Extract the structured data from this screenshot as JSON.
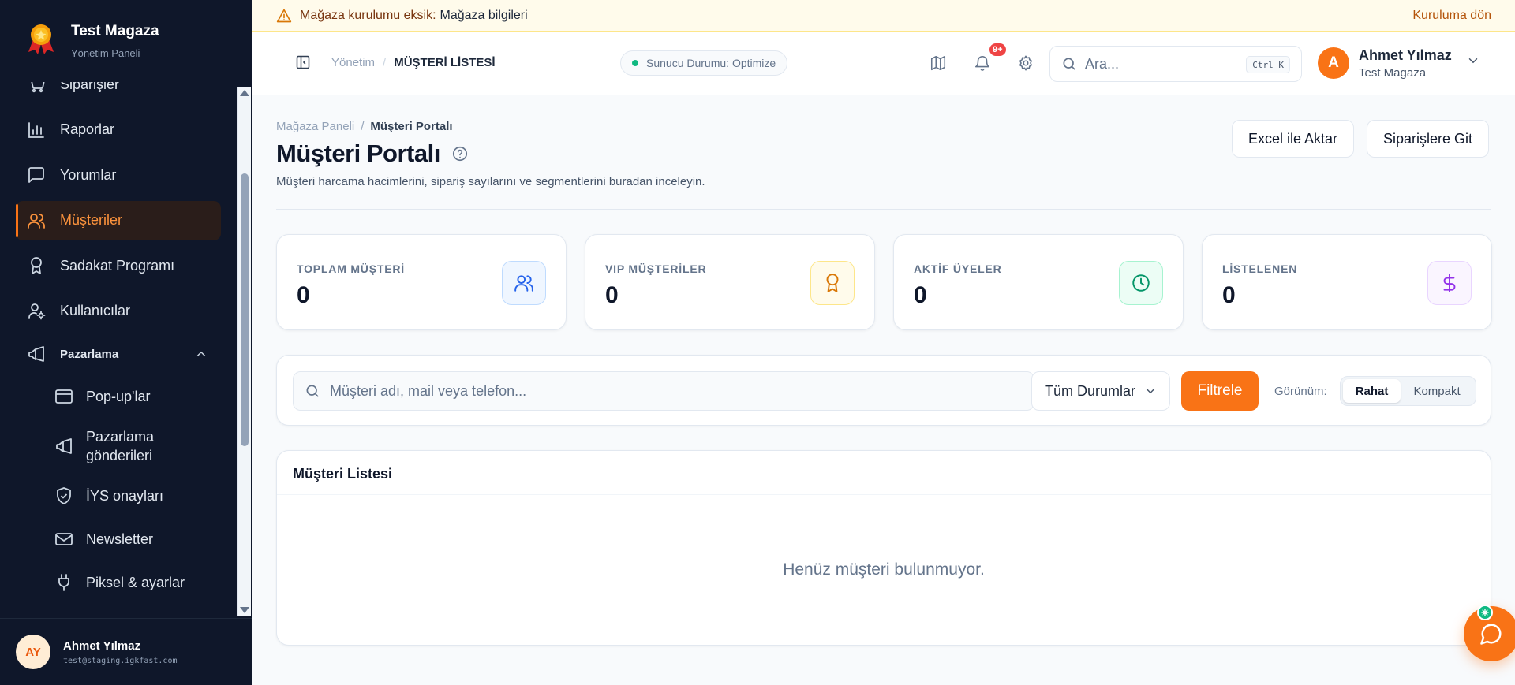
{
  "brand": {
    "name": "Test Magaza",
    "subtitle": "Yönetim Paneli"
  },
  "sidebar": {
    "items": [
      {
        "label": "Siparişler",
        "icon": "shopping-cart-icon"
      },
      {
        "label": "Raporlar",
        "icon": "bar-chart-icon"
      },
      {
        "label": "Yorumlar",
        "icon": "message-square-icon"
      },
      {
        "label": "Müşteriler",
        "icon": "users-icon",
        "active": true
      },
      {
        "label": "Sadakat Programı",
        "icon": "award-icon"
      },
      {
        "label": "Kullanıcılar",
        "icon": "user-cog-icon"
      }
    ],
    "group": {
      "label": "Pazarlama",
      "icon": "megaphone-icon",
      "expanded": true,
      "items": [
        {
          "label": "Pop-up'lar",
          "icon": "browser-window-icon"
        },
        {
          "label": "Pazarlama gönderileri",
          "icon": "megaphone-icon"
        },
        {
          "label": "İYS onayları",
          "icon": "shield-check-icon"
        },
        {
          "label": "Newsletter",
          "icon": "mail-icon"
        },
        {
          "label": "Piksel & ayarlar",
          "icon": "plug-icon"
        }
      ]
    },
    "user": {
      "initials": "AY",
      "name": "Ahmet Yılmaz",
      "email": "test@staging.igkfast.com"
    }
  },
  "banner": {
    "text": "Mağaza kurulumu eksik:",
    "highlight": "Mağaza bilgileri",
    "action": "Kuruluma dön"
  },
  "header": {
    "breadcrumb": [
      "Yönetim",
      "MÜŞTERİ LİSTESİ"
    ],
    "status": "Sunucu Durumu: Optimize",
    "notifications_badge": "9+",
    "search_placeholder": "Ara...",
    "search_shortcut": "Ctrl K",
    "user": {
      "initial": "A",
      "name": "Ahmet Yılmaz",
      "store": "Test Magaza"
    }
  },
  "page": {
    "breadcrumb": [
      "Mağaza Paneli",
      "Müşteri Portalı"
    ],
    "title": "Müşteri Portalı",
    "description": "Müşteri harcama hacimlerini, sipariş sayılarını ve segmentlerini buradan inceleyin.",
    "actions": {
      "export": "Excel ile Aktar",
      "orders": "Siparişlere Git"
    }
  },
  "stats": [
    {
      "label": "TOPLAM MÜŞTERİ",
      "value": "0",
      "icon": "users-icon",
      "color": "#2563eb",
      "bg": "#eff6ff"
    },
    {
      "label": "VIP MÜŞTERİLER",
      "value": "0",
      "icon": "award-icon",
      "color": "#d97706",
      "bg": "#fffbeb"
    },
    {
      "label": "AKTİF ÜYELER",
      "value": "0",
      "icon": "clock-icon",
      "color": "#059669",
      "bg": "#ecfdf5"
    },
    {
      "label": "LİSTELENEN",
      "value": "0",
      "icon": "dollar-icon",
      "color": "#9333ea",
      "bg": "#faf5ff"
    }
  ],
  "filters": {
    "search_placeholder": "Müşteri adı, mail veya telefon...",
    "status_selected": "Tüm Durumlar",
    "filter_button": "Filtrele",
    "view_label": "Görünüm:",
    "view_options": [
      "Rahat",
      "Kompakt"
    ],
    "view_selected": "Rahat"
  },
  "list": {
    "title": "Müşteri Listesi",
    "empty": "Henüz müşteri bulunmuyor."
  },
  "colors": {
    "accent": "#f97316",
    "sidebar_bg": "#0f172a",
    "banner_bg": "#fffbeb"
  }
}
